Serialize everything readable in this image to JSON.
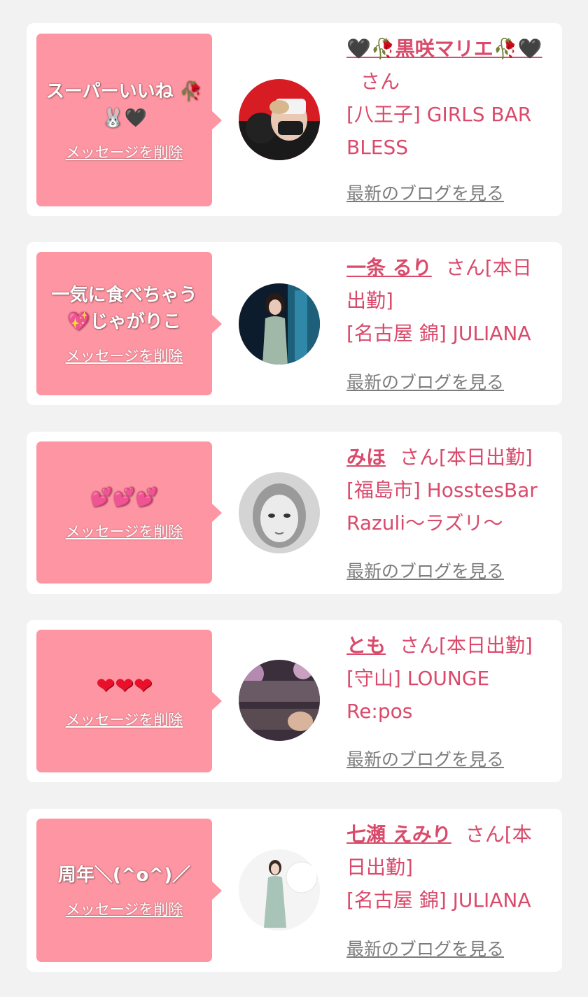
{
  "delete_label": "メッセージを削除",
  "blog_label": "最新のブログを見る",
  "san_label": "さん",
  "items": [
    {
      "message": "スーパーいいね",
      "message_emoji_1": "🥀",
      "message_emoji_2": "🐰",
      "message_emoji_3": "🖤",
      "name_prefix": "🖤🥀",
      "name": "黒咲マリエ",
      "name_suffix": "🥀🖤",
      "san": "さん",
      "status": "",
      "shop": "[八王子] GIRLS BAR BLESS"
    },
    {
      "message_line1": "一気に食べちゃう",
      "message_emoji": "💖",
      "message_line2": "じゃがりこ",
      "name": "一条 るり",
      "san": "さん",
      "status": "[本日出勤]",
      "shop": "[名古屋 錦] JULIANA"
    },
    {
      "message": "💕💕💕",
      "name": "みほ",
      "san": "さん",
      "status": "[本日出勤]",
      "shop": "[福島市] HosstesBar Razuli〜ラズリ〜"
    },
    {
      "message": "❤❤❤",
      "name": "とも",
      "san": "さん",
      "status": "[本日出勤]",
      "shop": "[守山] LOUNGE Re:pos"
    },
    {
      "message": "周年＼(^o^)／",
      "name": "七瀬 えみり",
      "san": "さん",
      "status": "[本日出勤]",
      "shop": "[名古屋 錦] JULIANA"
    }
  ],
  "colors": {
    "background": "#f2f2f2",
    "card": "#ffffff",
    "bubble": "#fe95a2",
    "accent_text": "#d94a6b",
    "link_gray": "#7c7c7c"
  }
}
